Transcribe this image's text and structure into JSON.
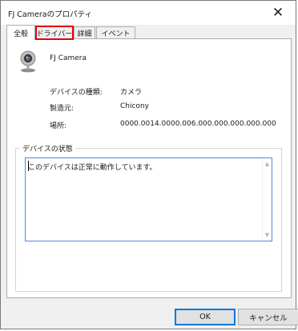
{
  "window": {
    "title": "FJ Cameraのプロパティ",
    "close_glyph": "✕"
  },
  "tabs": [
    {
      "label": "全般",
      "active": true
    },
    {
      "label": "ドライバー",
      "highlighted": true,
      "highlight_color": "#e60012"
    },
    {
      "label": "詳細"
    },
    {
      "label": "イベント"
    }
  ],
  "device": {
    "name": "FJ Camera",
    "icon": "webcam-icon"
  },
  "properties": [
    {
      "label": "デバイスの種類:",
      "value": "カメラ"
    },
    {
      "label": "製造元:",
      "value": "Chicony"
    },
    {
      "label": "場所:",
      "value": "0000.0014.0000.006.000.000.000.000.000"
    }
  ],
  "status_group": {
    "title": "デバイスの状態",
    "text": "このデバイスは正常に動作しています。"
  },
  "scrollbar": {
    "up_glyph": "▲",
    "down_glyph": "▼"
  },
  "buttons": {
    "ok": "OK",
    "cancel": "キャンセル"
  },
  "colors": {
    "focus_border": "#0078d7",
    "highlight": "#e60012"
  }
}
